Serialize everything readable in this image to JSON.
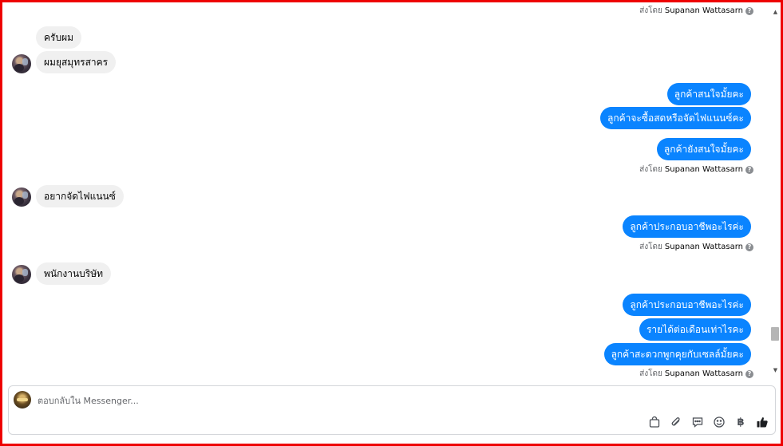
{
  "conversation": {
    "sent_by_prefix": "ส่งโดย",
    "sent_by_name": "Supanan Wattasarn",
    "messages": [
      {
        "text": "ครับผม"
      },
      {
        "text": "ผมยุสมุทรสาคร"
      },
      {
        "text": "ลูกค้าสนใจมั้ยคะ"
      },
      {
        "text": "ลูกค้าจะซื้อสดหรือจัดไฟแนนซ์คะ"
      },
      {
        "text": "ลูกค้ายังสนใจมั้ยคะ"
      },
      {
        "text": "อยากจัดไฟแนนซ์"
      },
      {
        "text": "ลูกค้าประกอบอาชีพอะไรค่ะ"
      },
      {
        "text": "พนักงานบริษัท"
      },
      {
        "text": "ลูกค้าประกอบอาชีพอะไรค่ะ"
      },
      {
        "text": "รายได้ต่อเดือนเท่าไรคะ"
      },
      {
        "text": "ลูกค้าสะดวกพูกคุยกับเซลล์มั้ยคะ"
      }
    ]
  },
  "composer": {
    "placeholder": "ตอบกลับใน Messenger...",
    "value": "",
    "tools": [
      "shopping-bag-icon",
      "attachment-icon",
      "saved-reply-icon",
      "emoji-icon",
      "baht-icon",
      "thumbs-up-icon"
    ],
    "baht_symbol": "฿"
  },
  "colors": {
    "outgoing_bubble": "#0a84ff",
    "incoming_bubble": "#f0f0f0",
    "frame_border": "#ee0000"
  }
}
